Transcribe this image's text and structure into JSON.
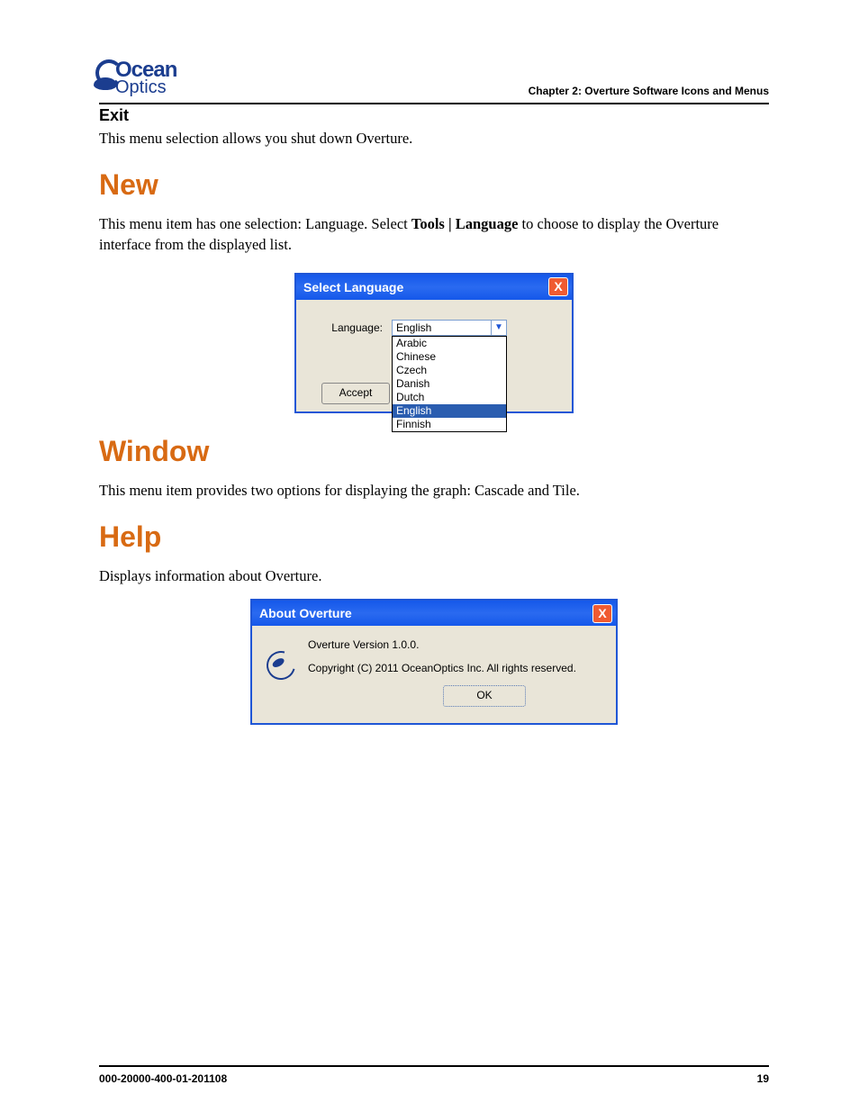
{
  "header": {
    "logo_top": "Ocean",
    "logo_bot": "Optics",
    "chapter": "Chapter 2: Overture Software Icons and Menus"
  },
  "exit": {
    "heading": "Exit",
    "text": "This menu selection allows you shut down Overture."
  },
  "new": {
    "heading": "New",
    "text_pre": "This menu item has one selection: Language. Select ",
    "text_bold": "Tools | Language",
    "text_post": " to choose to display the Overture interface from the displayed list."
  },
  "lang_dialog": {
    "title": "Select Language",
    "close": "X",
    "label": "Language:",
    "selected": "English",
    "options": [
      "Arabic",
      "Chinese",
      "Czech",
      "Danish",
      "Dutch",
      "English",
      "Finnish"
    ],
    "highlighted": "English",
    "accept": "Accept"
  },
  "window": {
    "heading": "Window",
    "text": "This menu item provides two options for displaying the graph: Cascade and Tile."
  },
  "help": {
    "heading": "Help",
    "text": "Displays information about Overture."
  },
  "about_dialog": {
    "title": "About Overture",
    "close": "X",
    "line1": "Overture Version 1.0.0.",
    "line2": "Copyright (C) 2011 OceanOptics Inc.  All rights reserved.",
    "ok": "OK"
  },
  "footer": {
    "docnum": "000-20000-400-01-201108",
    "page": "19"
  }
}
